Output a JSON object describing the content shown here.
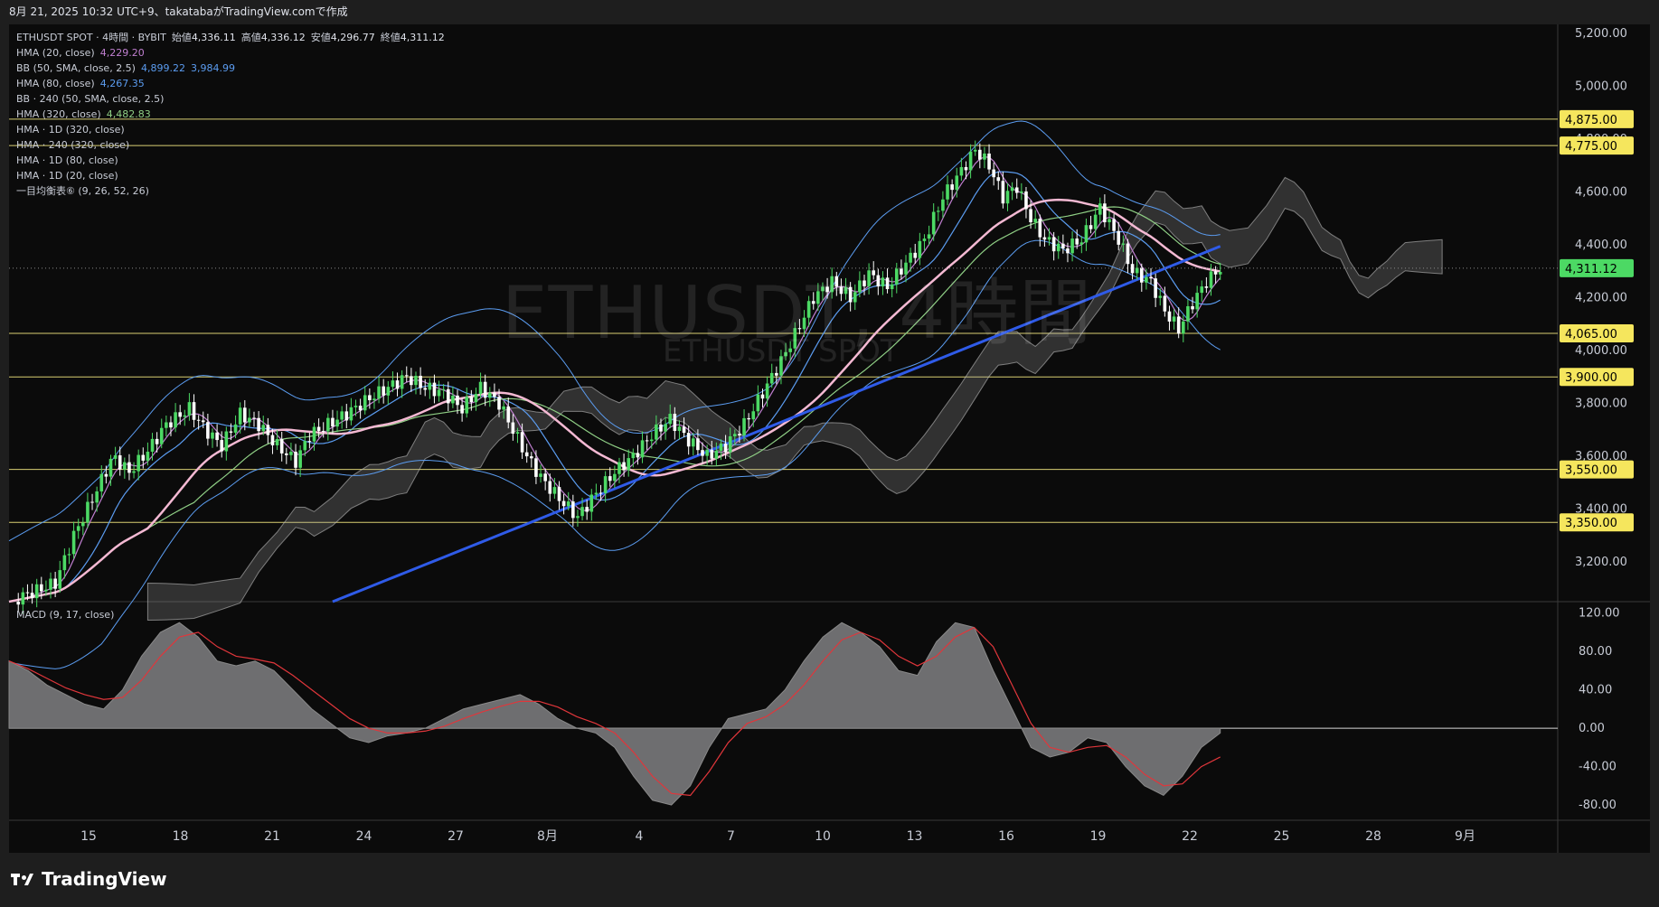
{
  "header": {
    "caption": "8月 21, 2025 10:32 UTC+9、takatabaがTradingView.comで作成"
  },
  "legend": [
    {
      "label": "ETHUSDT SPOT · 4時間 · BYBIT",
      "parts": [
        {
          "k": "始値",
          "v": "4,336.11"
        },
        {
          "k": "高値",
          "v": "4,336.12"
        },
        {
          "k": "安値",
          "v": "4,296.77"
        },
        {
          "k": "終値",
          "v": "4,311.12"
        }
      ]
    },
    {
      "label": "HMA (20, close)",
      "values": [
        "4,229.20"
      ],
      "color": "#c07fd0"
    },
    {
      "label": "BB (50, SMA, close, 2.5)",
      "values": [
        "4,899.22",
        "3,984.99"
      ],
      "color": "#5b9cf0"
    },
    {
      "label": "HMA (80, close)",
      "values": [
        "4,267.35"
      ],
      "color": "#5b9cf0"
    },
    {
      "label": "BB · 240 (50, SMA, close, 2.5)",
      "values": []
    },
    {
      "label": "HMA (320, close)",
      "values": [
        "4,482.83"
      ],
      "color": "#8fcf85"
    },
    {
      "label": "HMA · 1D (320, close)",
      "values": []
    },
    {
      "label": "HMA · 240 (320, close)",
      "values": []
    },
    {
      "label": "HMA · 1D (80, close)",
      "values": []
    },
    {
      "label": "HMA · 1D (20, close)",
      "values": []
    },
    {
      "label": "一目均衡表⑥ (9, 26, 52, 26)",
      "values": []
    }
  ],
  "watermark": {
    "main": "ETHUSDT, 4時間",
    "sub": "ETHUSDT SPOT"
  },
  "macd_label": "MACD (9, 17, close)",
  "brand": "TradingView",
  "colors": {
    "up": "#4cd964",
    "down": "#ffffff",
    "hma20": "#c07fd0",
    "hma80": "#5b9cf0",
    "hma320": "#8fcf85",
    "hma1d": "#2f5be8",
    "pink": "#f4b9d3",
    "hline": "#d9cf73",
    "priceTag": "#f5e65d",
    "lastTag": "#4cd964",
    "macdFill": "#6e6e70",
    "signal": "#e0363b"
  },
  "chart_data": [
    {
      "type": "candlestick",
      "symbol": "ETHUSDT SPOT",
      "interval": "4時間",
      "ylim": [
        3050,
        5230
      ],
      "yticks": [
        "5,200.00",
        "5,000.00",
        "4,800.00",
        "4,600.00",
        "4,400.00",
        "4,200.00",
        "4,000.00",
        "3,800.00",
        "3,600.00",
        "3,400.00",
        "3,200.00"
      ],
      "xticks": [
        "15",
        "18",
        "21",
        "24",
        "27",
        "8月",
        "4",
        "7",
        "10",
        "13",
        "16",
        "19",
        "22",
        "25",
        "28",
        "9月"
      ],
      "horizontal_levels": [
        4875,
        4775,
        4065,
        3900,
        3550,
        3350
      ],
      "level_labels": [
        "4,875.00",
        "4,775.00",
        "4,065.00",
        "3,900.00",
        "3,550.00",
        "3,350.00"
      ],
      "last_price": 4311.12,
      "last_price_label": "4,311.12",
      "close_path": [
        [
          0,
          3050
        ],
        [
          20,
          3120
        ],
        [
          28,
          3300
        ],
        [
          35,
          3420
        ],
        [
          45,
          3600
        ],
        [
          52,
          3540
        ],
        [
          60,
          3620
        ],
        [
          68,
          3720
        ],
        [
          78,
          3780
        ],
        [
          85,
          3700
        ],
        [
          92,
          3640
        ],
        [
          100,
          3760
        ],
        [
          108,
          3720
        ],
        [
          116,
          3640
        ],
        [
          124,
          3580
        ],
        [
          130,
          3680
        ],
        [
          138,
          3720
        ],
        [
          146,
          3760
        ],
        [
          156,
          3820
        ],
        [
          164,
          3860
        ],
        [
          172,
          3900
        ],
        [
          180,
          3860
        ],
        [
          188,
          3840
        ],
        [
          196,
          3780
        ],
        [
          204,
          3860
        ],
        [
          212,
          3800
        ],
        [
          218,
          3700
        ],
        [
          224,
          3600
        ],
        [
          230,
          3520
        ],
        [
          238,
          3440
        ],
        [
          246,
          3370
        ],
        [
          254,
          3460
        ],
        [
          262,
          3540
        ],
        [
          270,
          3600
        ],
        [
          278,
          3680
        ],
        [
          286,
          3740
        ],
        [
          294,
          3660
        ],
        [
          302,
          3600
        ],
        [
          310,
          3640
        ],
        [
          318,
          3720
        ],
        [
          326,
          3840
        ],
        [
          334,
          3960
        ],
        [
          340,
          4060
        ],
        [
          348,
          4200
        ],
        [
          356,
          4260
        ],
        [
          364,
          4200
        ],
        [
          372,
          4290
        ],
        [
          380,
          4240
        ],
        [
          388,
          4330
        ],
        [
          396,
          4420
        ],
        [
          404,
          4580
        ],
        [
          412,
          4680
        ],
        [
          418,
          4760
        ],
        [
          424,
          4700
        ],
        [
          430,
          4580
        ],
        [
          436,
          4620
        ],
        [
          442,
          4500
        ],
        [
          448,
          4420
        ],
        [
          456,
          4380
        ],
        [
          464,
          4420
        ],
        [
          472,
          4540
        ],
        [
          480,
          4420
        ],
        [
          486,
          4300
        ],
        [
          494,
          4260
        ],
        [
          500,
          4150
        ],
        [
          506,
          4080
        ],
        [
          512,
          4180
        ],
        [
          518,
          4260
        ],
        [
          524,
          4311
        ]
      ],
      "x_domain": [
        0,
        670
      ]
    },
    {
      "type": "line",
      "title": "MACD (9, 17, close)",
      "ylim": [
        -95,
        130
      ],
      "yticks": [
        "120.00",
        "80.00",
        "40.00",
        "0.00",
        "-40.00",
        "-80.00"
      ],
      "yvalues": [
        120,
        80,
        40,
        0,
        -40,
        -80
      ],
      "series": [
        {
          "name": "MACD",
          "style": "area",
          "values": [
            70,
            60,
            45,
            35,
            25,
            20,
            40,
            75,
            100,
            110,
            95,
            70,
            65,
            70,
            60,
            40,
            20,
            5,
            -10,
            -15,
            -8,
            -5,
            0,
            10,
            20,
            25,
            30,
            35,
            25,
            10,
            0,
            -5,
            -20,
            -50,
            -75,
            -80,
            -60,
            -20,
            10,
            15,
            20,
            40,
            70,
            95,
            110,
            100,
            85,
            60,
            55,
            90,
            110,
            105,
            60,
            20,
            -20,
            -30,
            -25,
            -10,
            -15,
            -40,
            -60,
            -70,
            -50,
            -20,
            -5
          ]
        },
        {
          "name": "Signal",
          "style": "line",
          "values": [
            70,
            62,
            52,
            42,
            35,
            30,
            32,
            50,
            75,
            95,
            100,
            85,
            75,
            72,
            68,
            55,
            40,
            25,
            10,
            0,
            -5,
            -5,
            -3,
            2,
            10,
            17,
            23,
            28,
            28,
            22,
            12,
            5,
            -5,
            -25,
            -50,
            -68,
            -70,
            -45,
            -15,
            5,
            12,
            25,
            45,
            70,
            92,
            100,
            92,
            75,
            65,
            75,
            95,
            105,
            85,
            45,
            5,
            -20,
            -25,
            -20,
            -18,
            -30,
            -48,
            -60,
            -58,
            -40,
            -30
          ]
        }
      ]
    }
  ]
}
